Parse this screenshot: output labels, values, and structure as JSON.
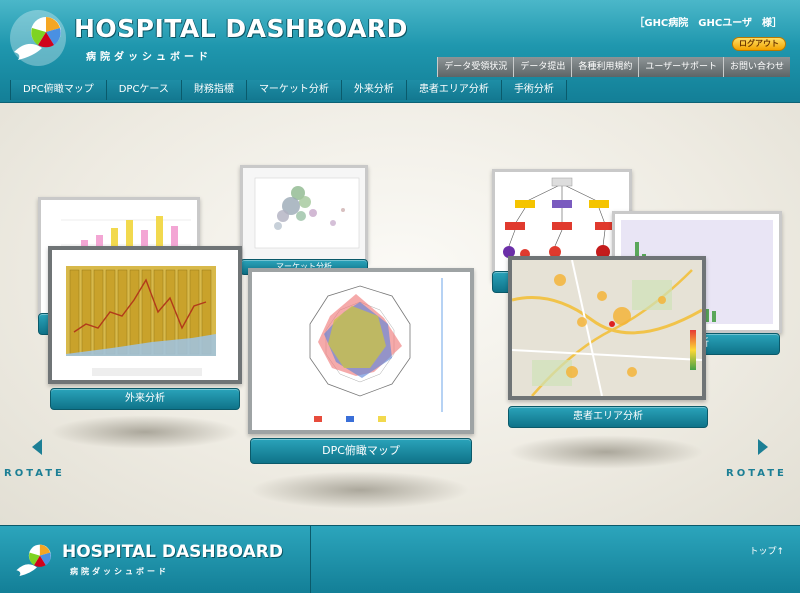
{
  "header": {
    "title": "HOSPITAL DASHBOARD",
    "subtitle": "病院ダッシュボード",
    "user_info": "［GHC病院　GHCユーザ　様］",
    "logout_label": "ログアウト",
    "util_links": [
      "データ受領状況",
      "データ提出",
      "各種利用規約",
      "ユーザーサポート",
      "お問い合わせ"
    ],
    "nav": [
      "DPC俯瞰マップ",
      "DPCケース",
      "財務指標",
      "マーケット分析",
      "外来分析",
      "患者エリア分析",
      "手術分析"
    ]
  },
  "carousel": {
    "cards": {
      "center": "DPC俯瞰マップ",
      "front_left": "外来分析",
      "front_right": "患者エリア分析",
      "back_center": "マーケット分析",
      "back_right_partial": "析"
    },
    "rotate_left": "ROTATE",
    "rotate_right": "ROTATE"
  },
  "footer": {
    "title": "HOSPITAL DASHBOARD",
    "subtitle": "病院ダッシュボード",
    "top_link": "トップ↑"
  },
  "colors": {
    "primary_teal": "#137f97",
    "accent_orange": "#f2a300",
    "util_gray": "#6d7476"
  },
  "icons": {
    "logo": "dolphin-pie-logo-icon",
    "left_arrow": "chevron-left-icon",
    "right_arrow": "chevron-right-icon"
  }
}
